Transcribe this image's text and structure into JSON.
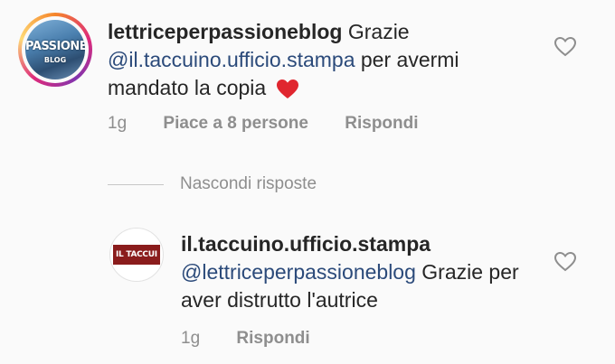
{
  "comment": {
    "username": "lettriceperpassioneblog",
    "text_before": "Grazie",
    "mention": "@il.taccuino.ufficio.stampa",
    "text_after": "per avermi mandato la copia",
    "emoji": "red-heart",
    "time": "1g",
    "likes": "Piace a 8 persone",
    "reply_label": "Rispondi",
    "avatar_text_top": "PASSIONE",
    "avatar_text_bottom": "BLOG"
  },
  "hide_replies_label": "Nascondi risposte",
  "reply": {
    "username": "il.taccuino.ufficio.stampa",
    "mention": "@lettriceperpassioneblog",
    "text_after": "Grazie per aver distrutto l'autrice",
    "time": "1g",
    "reply_label": "Rispondi",
    "avatar_text": "IL TACCUI"
  },
  "colors": {
    "mention": "#2b4a7a",
    "meta": "#8e8e8e",
    "heart_emoji": "#e0262f"
  },
  "icons": {
    "like": "heart-outline-icon"
  }
}
